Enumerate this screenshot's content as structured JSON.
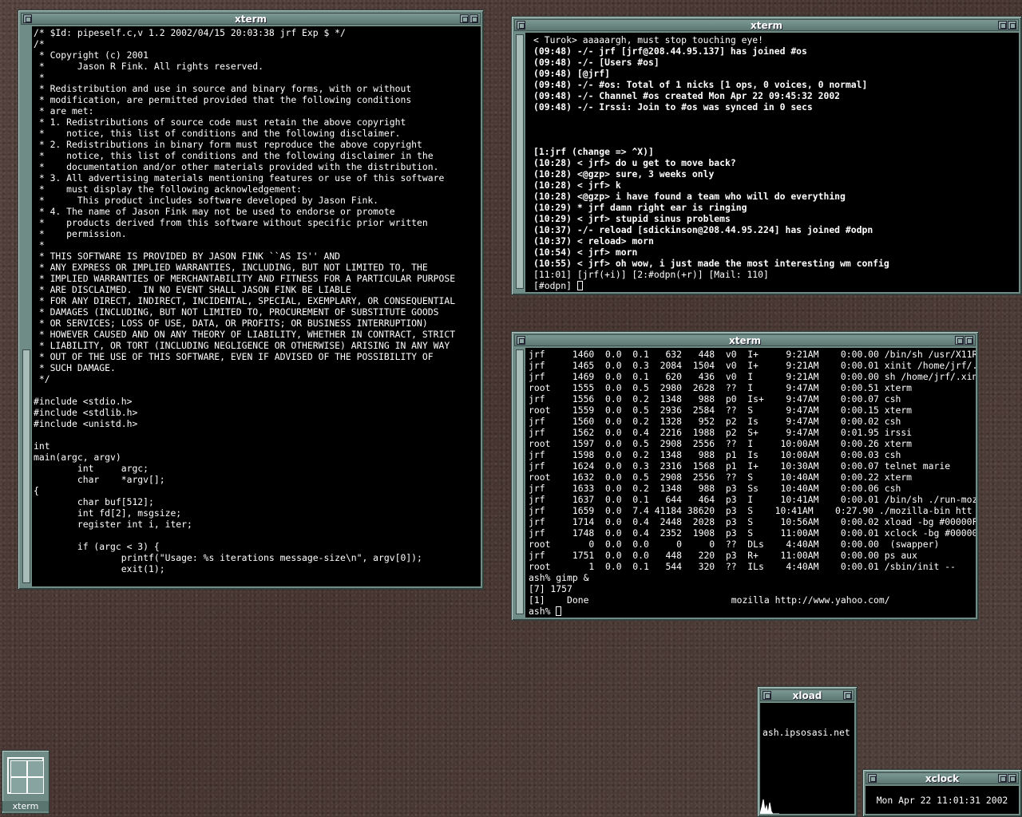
{
  "windows": {
    "source": {
      "title": "xterm",
      "lines": [
        "/* $Id: pipeself.c,v 1.2 2002/04/15 20:03:38 jrf Exp $ */",
        "/*",
        " * Copyright (c) 2001",
        " *      Jason R Fink. All rights reserved.",
        " *",
        " * Redistribution and use in source and binary forms, with or without",
        " * modification, are permitted provided that the following conditions",
        " * are met:",
        " * 1. Redistributions of source code must retain the above copyright",
        " *    notice, this list of conditions and the following disclaimer.",
        " * 2. Redistributions in binary form must reproduce the above copyright",
        " *    notice, this list of conditions and the following disclaimer in the",
        " *    documentation and/or other materials provided with the distribution.",
        " * 3. All advertising materials mentioning features or use of this software",
        " *    must display the following acknowledgement:",
        " *      This product includes software developed by Jason Fink.",
        " * 4. The name of Jason Fink may not be used to endorse or promote",
        " *    products derived from this software without specific prior written",
        " *    permission.",
        " *",
        " * THIS SOFTWARE IS PROVIDED BY JASON FINK ``AS IS'' AND",
        " * ANY EXPRESS OR IMPLIED WARRANTIES, INCLUDING, BUT NOT LIMITED TO, THE",
        " * IMPLIED WARRANTIES OF MERCHANTABILITY AND FITNESS FOR A PARTICULAR PURPOSE",
        " * ARE DISCLAIMED.  IN NO EVENT SHALL JASON FINK BE LIABLE",
        " * FOR ANY DIRECT, INDIRECT, INCIDENTAL, SPECIAL, EXEMPLARY, OR CONSEQUENTIAL",
        " * DAMAGES (INCLUDING, BUT NOT LIMITED TO, PROCUREMENT OF SUBSTITUTE GOODS",
        " * OR SERVICES; LOSS OF USE, DATA, OR PROFITS; OR BUSINESS INTERRUPTION)",
        " * HOWEVER CAUSED AND ON ANY THEORY OF LIABILITY, WHETHER IN CONTRACT, STRICT",
        " * LIABILITY, OR TORT (INCLUDING NEGLIGENCE OR OTHERWISE) ARISING IN ANY WAY",
        " * OUT OF THE USE OF THIS SOFTWARE, EVEN IF ADVISED OF THE POSSIBILITY OF",
        " * SUCH DAMAGE.",
        " */",
        "",
        "#include <stdio.h>",
        "#include <stdlib.h>",
        "#include <unistd.h>",
        "",
        "int",
        "main(argc, argv)",
        "        int     argc;",
        "        char    *argv[];",
        "{",
        "        char buf[512];",
        "        int fd[2], msgsize;",
        "        register int i, iter;",
        "",
        "        if (argc < 3) {",
        "                printf(\"Usage: %s iterations message-size\\n\", argv[0]);",
        "                exit(1);"
      ]
    },
    "irc": {
      "title": "xterm",
      "lines": [
        "< Turok> aaaaargh, must stop touching eye!",
        "(09:48) -/- jrf [jrf@208.44.95.137] has joined #os",
        "(09:48) -/- [Users #os]",
        "(09:48) [@jrf]",
        "(09:48) -/- #os: Total of 1 nicks [1 ops, 0 voices, 0 normal]",
        "(09:48) -/- Channel #os created Mon Apr 22 09:45:32 2002",
        "(09:48) -/- Irssi: Join to #os was synced in 0 secs",
        "",
        "",
        "",
        "[1:jrf (change => ^X)]",
        "(10:28) < jrf> do u get to move back?",
        "(10:28) <@gzp> sure, 3 weeks only",
        "(10:28) < jrf> k",
        "(10:28) <@gzp> i have found a team who will do everything",
        "(10:29) * jrf damn right ear is ringing",
        "(10:29) < jrf> stupid sinus problems",
        "(10:37) -/- reload [sdickinson@208.44.95.224] has joined #odpn",
        "(10:37) < reload> morn",
        "(10:54) < jrf> morn",
        "(10:55) < jrf> oh wow, i just made the most interesting wm config",
        "[11:01] [jrf(+i)] [2:#odpn(+r)] [Mail: 110]"
      ],
      "prompt": "[#odpn] "
    },
    "ps": {
      "title": "xterm",
      "lines": [
        "jrf     1460  0.0  0.1   632   448  v0  I+     9:21AM    0:00.00 /bin/sh /usr/X11R",
        "jrf     1465  0.0  0.3  2084  1504  v0  I+     9:21AM    0:00.01 xinit /home/jrf/.",
        "jrf     1469  0.0  0.1   620   436  v0  I      9:21AM    0:00.00 sh /home/jrf/.xin",
        "root    1555  0.0  0.5  2980  2628  ??  I      9:47AM    0:00.51 xterm",
        "jrf     1556  0.0  0.2  1348   988  p0  Is+    9:47AM    0:00.07 csh",
        "root    1559  0.0  0.5  2936  2584  ??  S      9:47AM    0:00.15 xterm",
        "jrf     1560  0.0  0.2  1328   952  p2  Is     9:47AM    0:00.02 csh",
        "jrf     1562  0.0  0.4  2216  1988  p2  S+     9:47AM    0:01.95 irssi",
        "root    1597  0.0  0.5  2908  2556  ??  I     10:00AM    0:00.26 xterm",
        "jrf     1598  0.0  0.2  1348   988  p1  Is    10:00AM    0:00.03 csh",
        "jrf     1624  0.0  0.3  2316  1568  p1  I+    10:30AM    0:00.07 telnet marie",
        "root    1632  0.0  0.5  2908  2556  ??  S     10:40AM    0:00.22 xterm",
        "jrf     1633  0.0  0.2  1348   988  p3  Ss    10:40AM    0:00.06 csh",
        "jrf     1637  0.0  0.1   644   464  p3  I     10:41AM    0:00.01 /bin/sh ./run-moz",
        "jrf     1659  0.0  7.4 41184 38620  p3  S    10:41AM    0:27.90 ./mozilla-bin htt",
        "jrf     1714  0.0  0.4  2448  2028  p3  S     10:56AM    0:00.02 xload -bg #00000F",
        "jrf     1748  0.0  0.4  2352  1908  p3  S     11:00AM    0:00.01 xclock -bg #00000",
        "root       0  0.0  0.0     0     0  ??  DLs    4:40AM    0:00.00  (swapper)",
        "jrf     1751  0.0  0.0   448   220  p3  R+    11:00AM    0:00.00 ps aux",
        "root       1  0.0  0.1   544   320  ??  ILs    4:40AM    0:00.01 /sbin/init --",
        "ash% gimp &",
        "[7] 1757",
        "[1]    Done                          mozilla http://www.yahoo.com/"
      ],
      "prompt": "ash% "
    },
    "xload": {
      "title": "xload",
      "host": "ash.ipsosasi.net"
    },
    "xclock": {
      "title": "xclock",
      "time": "Mon Apr 22 11:01:31 2002"
    }
  },
  "icon": {
    "label": "xterm"
  },
  "colors": {
    "frame": "#6f8c87",
    "terminal_bg": "#000000",
    "terminal_fg": "#ffffff",
    "desktop": "#4a3a36"
  }
}
